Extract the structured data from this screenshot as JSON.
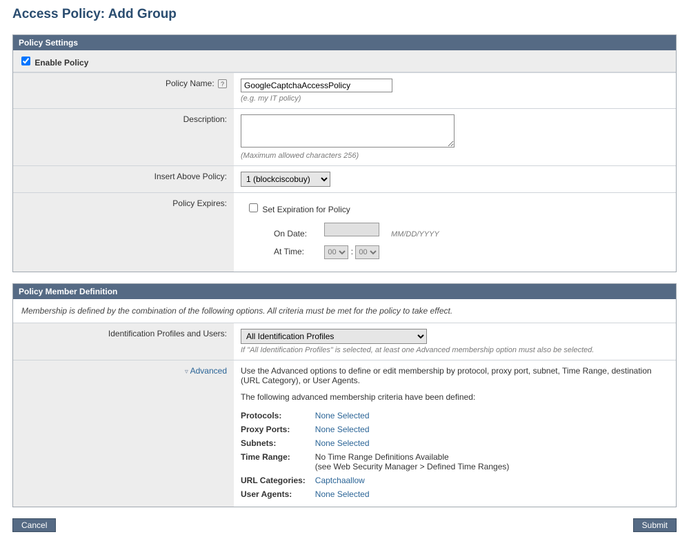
{
  "page": {
    "title": "Access Policy: Add Group"
  },
  "settings": {
    "header": "Policy Settings",
    "enable_label": "Enable Policy",
    "enable_checked": true,
    "policy_name": {
      "label": "Policy Name:",
      "value": "GoogleCaptchaAccessPolicy",
      "hint": "(e.g. my IT policy)"
    },
    "description": {
      "label": "Description:",
      "value": "",
      "hint": "(Maximum allowed characters 256)"
    },
    "insert_above": {
      "label": "Insert Above Policy:",
      "selected": "1 (blockciscobuy)"
    },
    "expires": {
      "label": "Policy Expires:",
      "set_label": "Set Expiration for Policy",
      "set_checked": false,
      "on_date_label": "On Date:",
      "on_date_hint": "MM/DD/YYYY",
      "at_time_label": "At Time:",
      "hour": "00",
      "minute": "00"
    }
  },
  "members": {
    "header": "Policy Member Definition",
    "note": "Membership is defined by the combination of the following options. All criteria must be met for the policy to take effect.",
    "id_profiles": {
      "label": "Identification Profiles and Users:",
      "selected": "All Identification Profiles",
      "hint": "If \"All Identification Profiles\" is selected, at least one Advanced membership option must also be selected."
    },
    "advanced": {
      "toggle": "Advanced",
      "desc": "Use the Advanced options to define or edit membership by protocol, proxy port, subnet, Time Range, destination (URL Category), or User Agents.",
      "defined_note": "The following advanced membership criteria have been defined:",
      "criteria": {
        "protocols": {
          "k": "Protocols:",
          "v": "None Selected"
        },
        "proxy_ports": {
          "k": "Proxy Ports:",
          "v": "None Selected"
        },
        "subnets": {
          "k": "Subnets:",
          "v": "None Selected"
        },
        "time_range": {
          "k": "Time Range:",
          "v1": "No Time Range Definitions Available",
          "v2": "(see Web Security Manager > Defined Time Ranges)"
        },
        "url_categories": {
          "k": "URL Categories:",
          "v": "Captchaallow"
        },
        "user_agents": {
          "k": "User Agents:",
          "v": "None Selected"
        }
      }
    }
  },
  "buttons": {
    "cancel": "Cancel",
    "submit": "Submit"
  }
}
